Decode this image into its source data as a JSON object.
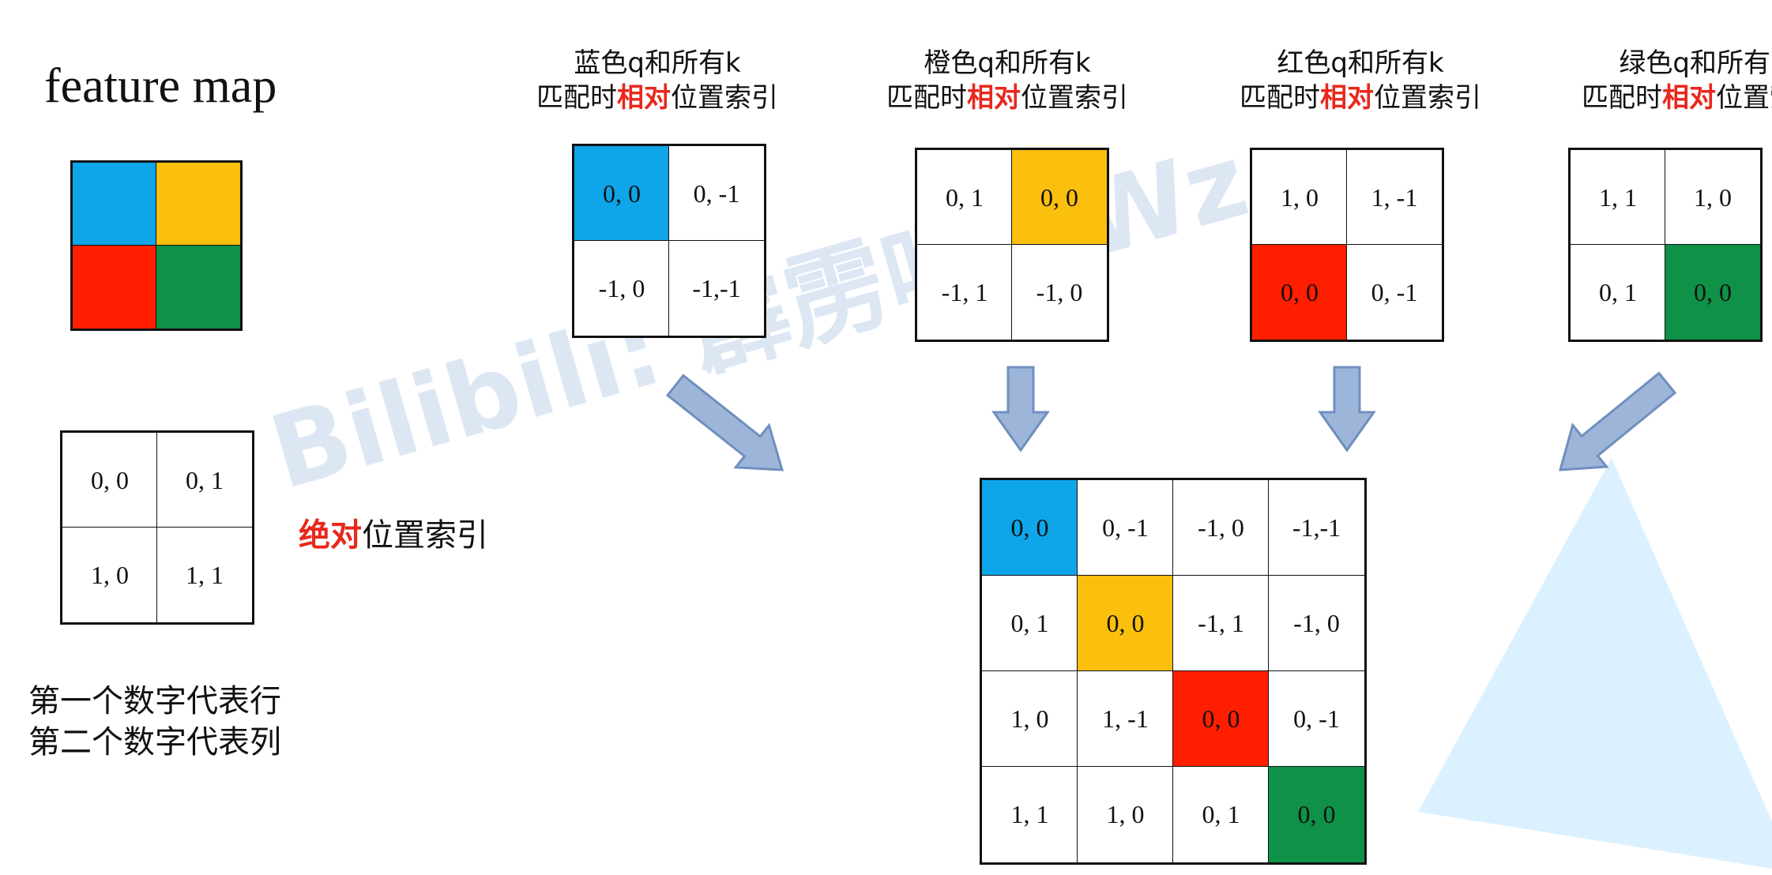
{
  "feature_map": {
    "title": "feature map",
    "colors": [
      "#0ea5e9",
      "#fbbf0e",
      "#ff1e00",
      "#0f9147"
    ]
  },
  "colors": {
    "blue": "#0ea5e9",
    "orange": "#fbbf0e",
    "red": "#ff1e00",
    "green": "#0f9147",
    "arrow_fill": "#9db5d8",
    "arrow_stroke": "#6f8fbe",
    "accent_text": "#e8281c"
  },
  "absolute": {
    "cells": [
      "0, 0",
      "0, 1",
      "1, 0",
      "1, 1"
    ],
    "label_highlight": "绝对",
    "label_rest": "位置索引"
  },
  "note": {
    "line1": "第一个数字代表行",
    "line2": "第二个数字代表列"
  },
  "relative_panels": [
    {
      "line1": "蓝色q和所有k",
      "line2_pre": "匹配时",
      "line2_highlight": "相对",
      "line2_post": "位置索引",
      "cells": [
        "0, 0",
        "0, -1",
        "-1, 0",
        "-1,-1"
      ],
      "colored_index": 0,
      "color": "#0ea5e9"
    },
    {
      "line1": "橙色q和所有k",
      "line2_pre": "匹配时",
      "line2_highlight": "相对",
      "line2_post": "位置索引",
      "cells": [
        "0, 1",
        "0, 0",
        "-1, 1",
        "-1, 0"
      ],
      "colored_index": 1,
      "color": "#fbbf0e"
    },
    {
      "line1": "红色q和所有k",
      "line2_pre": "匹配时",
      "line2_highlight": "相对",
      "line2_post": "位置索引",
      "cells": [
        "1, 0",
        "1, -1",
        "0, 0",
        "0, -1"
      ],
      "colored_index": 2,
      "color": "#ff1e00"
    },
    {
      "line1": "绿色q和所有k",
      "line2_pre": "匹配时",
      "line2_highlight": "相对",
      "line2_post": "位置索引",
      "cells": [
        "1, 1",
        "1, 0",
        "0, 1",
        "0, 0"
      ],
      "colored_index": 3,
      "color": "#0f9147"
    }
  ],
  "combined": {
    "rows": [
      [
        "0, 0",
        "0, -1",
        "-1, 0",
        "-1,-1"
      ],
      [
        "0, 1",
        "0, 0",
        "-1, 1",
        "-1, 0"
      ],
      [
        "1, 0",
        "1, -1",
        "0, 0",
        "0, -1"
      ],
      [
        "1, 1",
        "1, 0",
        "0, 1",
        "0, 0"
      ]
    ],
    "diagonal_colors": [
      "#0ea5e9",
      "#fbbf0e",
      "#ff1e00",
      "#0f9147"
    ]
  },
  "watermark": "Bilibili: 霹雳吧啦Wz"
}
